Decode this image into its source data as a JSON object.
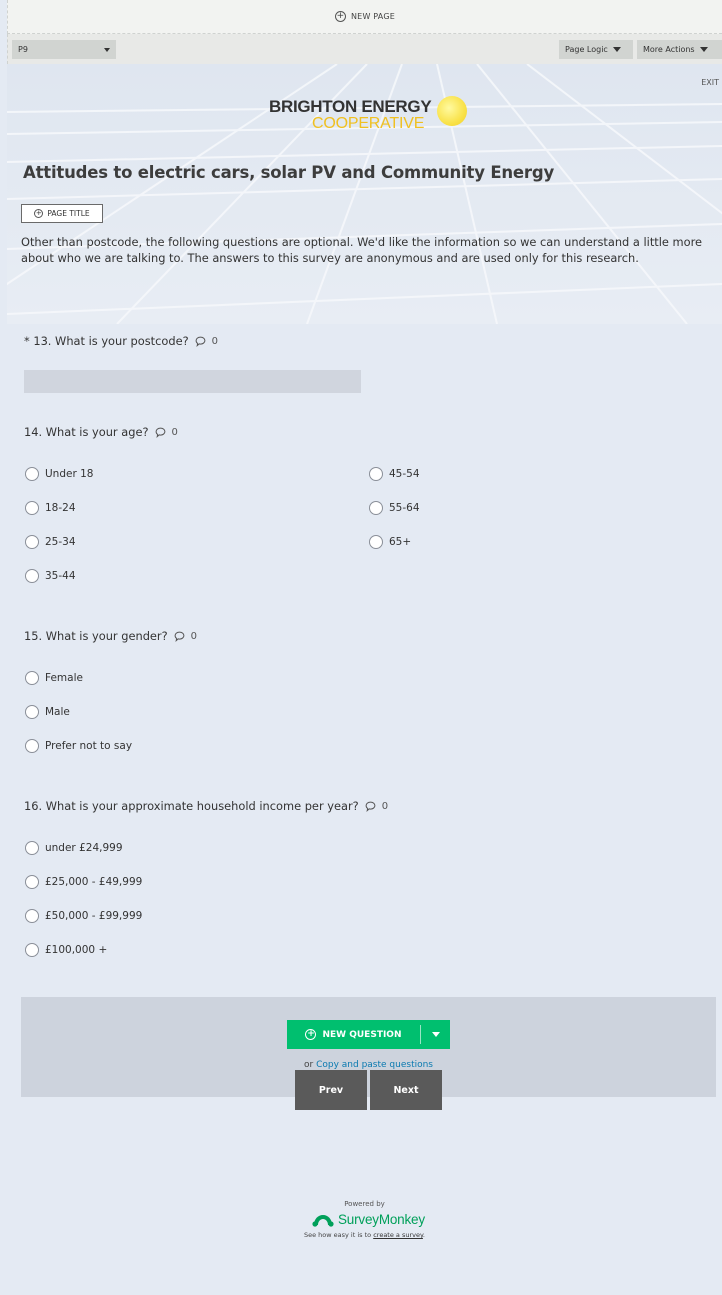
{
  "editor": {
    "new_page_label": "NEW PAGE",
    "page_select_value": "P9",
    "page_logic_label": "Page Logic",
    "more_actions_label": "More Actions"
  },
  "survey": {
    "exit_label": "EXIT",
    "logo": {
      "line1": "BRIGHTON ENERGY",
      "line2": "COOPERATIVE"
    },
    "title": "Attitudes to electric cars, solar PV and Community Energy",
    "page_title_button": "PAGE TITLE",
    "description": "Other than postcode, the following questions are optional. We'd like the information so we can understand a little more about who we are talking to. The answers to this survey are anonymous and are used only for this research.",
    "questions": [
      {
        "title": "* 13. What is your postcode?",
        "comments": "0"
      },
      {
        "title": "14. What is your age?",
        "comments": "0",
        "options": [
          "Under 18",
          "18-24",
          "25-34",
          "35-44",
          "45-54",
          "55-64",
          "65+"
        ]
      },
      {
        "title": "15. What is your gender?",
        "comments": "0",
        "options": [
          "Female",
          "Male",
          "Prefer not to say"
        ]
      },
      {
        "title": "16. What is your approximate household income per year?",
        "comments": "0",
        "options": [
          "under £24,999",
          "£25,000 - £49,999",
          "£50,000 - £99,999",
          "£100,000 +"
        ]
      }
    ],
    "new_question_label": "NEW QUESTION",
    "copy_prefix": "or",
    "copy_link": "Copy and paste questions",
    "prev_label": "Prev",
    "next_label": "Next"
  },
  "footer": {
    "powered_by": "Powered by",
    "brand": "SurveyMonkey",
    "tagline_prefix": "See how easy it is to",
    "tagline_link": "create a survey",
    "tagline_suffix": "."
  },
  "colors": {
    "accent_green": "#00bf6f",
    "nav_button": "#5a5a5a",
    "logo_yellow": "#f0c020"
  }
}
